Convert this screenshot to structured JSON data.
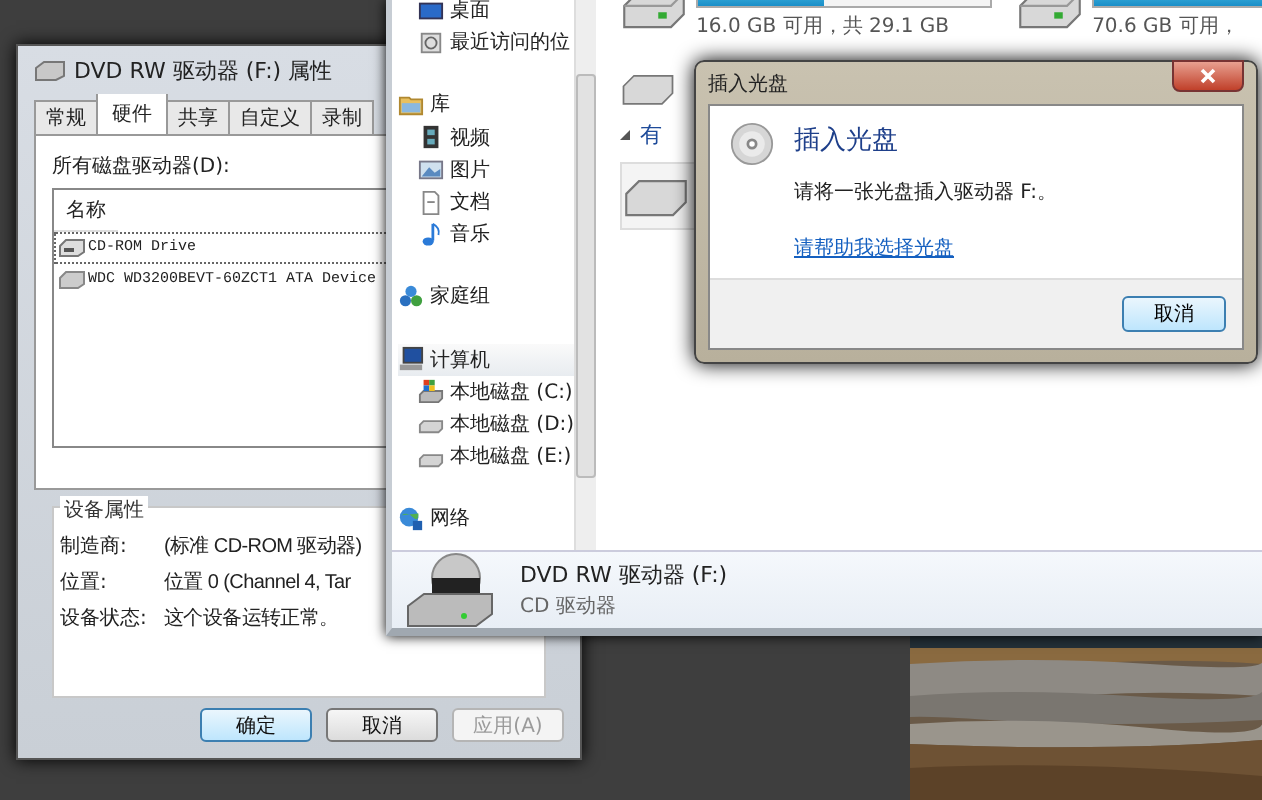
{
  "properties_window": {
    "title": "DVD RW 驱动器 (F:) 属性",
    "tabs": [
      {
        "label": "常规",
        "selected": false
      },
      {
        "label": "硬件",
        "selected": true
      },
      {
        "label": "共享",
        "selected": false
      },
      {
        "label": "自定义",
        "selected": false
      },
      {
        "label": "录制",
        "selected": false
      }
    ],
    "list_label": "所有磁盘驱动器(D):",
    "list": {
      "column": "名称",
      "rows": [
        {
          "text": "CD-ROM Drive",
          "kind": "cdrom",
          "selected": true
        },
        {
          "text": "WDC WD3200BEVT-60ZCT1 ATA Device",
          "kind": "disk",
          "selected": false
        }
      ]
    },
    "group": {
      "title": "设备属性",
      "rows": [
        {
          "label": "制造商:",
          "value": "(标准 CD-ROM 驱动器)"
        },
        {
          "label": "位置:",
          "value": "位置 0 (Channel 4, Tar"
        },
        {
          "label": "设备状态:",
          "value": "这个设备运转正常。"
        }
      ]
    },
    "buttons": [
      {
        "label": "确定",
        "kind": "default",
        "disabled": false
      },
      {
        "label": "取消",
        "kind": "normal",
        "disabled": false
      },
      {
        "label": "应用(A)",
        "kind": "normal",
        "disabled": true
      }
    ]
  },
  "explorer": {
    "drives": [
      {
        "free_text": "16.0 GB 可用，共 29.1 GB",
        "level": 0.43
      },
      {
        "free_text": "70.6 GB 可用，",
        "level": 0.7
      }
    ],
    "section_header": "有",
    "nav": [
      {
        "children": [
          {
            "label": "桌面",
            "kind": "desktop",
            "selected": false
          },
          {
            "label": "最近访问的位",
            "kind": "recent",
            "selected": false
          }
        ]
      },
      {
        "label": "库",
        "kind": "library",
        "selected": false,
        "children": [
          {
            "label": "视频",
            "kind": "video",
            "selected": false
          },
          {
            "label": "图片",
            "kind": "pictures",
            "selected": false
          },
          {
            "label": "文档",
            "kind": "document",
            "selected": false
          },
          {
            "label": "音乐",
            "kind": "music",
            "selected": false
          }
        ]
      },
      {
        "label": "家庭组",
        "kind": "homegroup",
        "selected": false
      },
      {
        "label": "计算机",
        "kind": "computer",
        "selected": true,
        "children": [
          {
            "label": "本地磁盘 (C:)",
            "kind": "system-disk",
            "selected": false
          },
          {
            "label": "本地磁盘 (D:)",
            "kind": "disk",
            "selected": false
          },
          {
            "label": "本地磁盘 (E:)",
            "kind": "disk",
            "selected": false
          }
        ]
      },
      {
        "label": "网络",
        "kind": "network",
        "selected": false
      }
    ],
    "details": {
      "name": "DVD RW 驱动器 (F:)",
      "type": "CD 驱动器"
    }
  },
  "dialog": {
    "title": "插入光盘",
    "heading": "插入光盘",
    "message": "请将一张光盘插入驱动器 F:。",
    "link": "请帮助我选择光盘",
    "buttons": [
      "取消"
    ]
  }
}
